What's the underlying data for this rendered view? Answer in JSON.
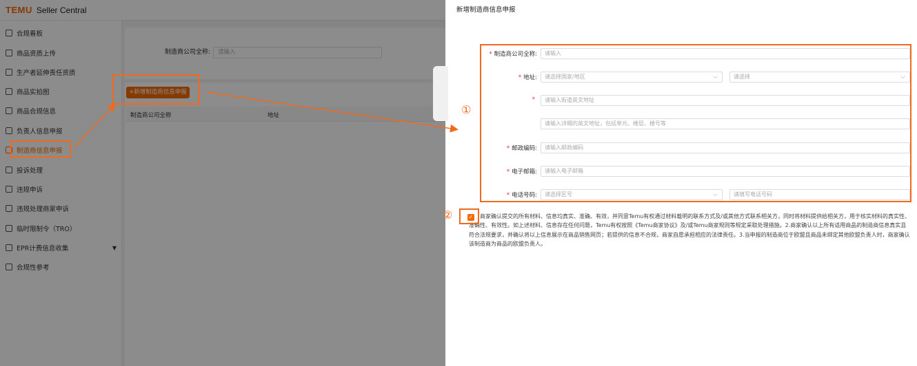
{
  "header": {
    "logo": "TEMU",
    "app_name": "Seller Central"
  },
  "sidebar": {
    "items": [
      {
        "label": "合规看板",
        "icon": "dashboard-icon"
      },
      {
        "label": "商品资质上传",
        "icon": "upload-icon"
      },
      {
        "label": "生产者延伸责任资质",
        "icon": "certificate-icon"
      },
      {
        "label": "商品实拍图",
        "icon": "photo-icon"
      },
      {
        "label": "商品合规信息",
        "icon": "document-icon"
      },
      {
        "label": "负责人信息申报",
        "icon": "person-icon"
      },
      {
        "label": "制造商信息申报",
        "icon": "factory-icon"
      },
      {
        "label": "投诉处理",
        "icon": "alert-icon"
      },
      {
        "label": "违规申诉",
        "icon": "appeal-icon"
      },
      {
        "label": "违规处理商家申诉",
        "icon": "store-icon"
      },
      {
        "label": "临时限制令（TRO）",
        "icon": "calendar-icon"
      },
      {
        "label": "EPR计费信息收集",
        "icon": "billing-icon"
      },
      {
        "label": "合规性参考",
        "icon": "book-icon"
      }
    ]
  },
  "main": {
    "filter_label": "制造商公司全称:",
    "filter_placeholder": "请输入",
    "add_button": "+新增制造商信息申报",
    "columns": [
      "制造商公司全称",
      "地址"
    ]
  },
  "drawer": {
    "title": "新增制造商信息申报",
    "fields": {
      "company": {
        "label": "制造商公司全称:",
        "placeholder": "请输入"
      },
      "address": {
        "label": "地址:",
        "country_placeholder": "请选择国家/地区",
        "region_placeholder": "请选择"
      },
      "street": {
        "placeholder": "请输入街道英文地址"
      },
      "detail": {
        "placeholder": "请输入详细的英文地址，包括单元、楼层、楼号等"
      },
      "postal": {
        "label": "邮政编码:",
        "placeholder": "请输入邮政编码"
      },
      "email": {
        "label": "电子邮箱:",
        "placeholder": "请输入电子邮箱"
      },
      "phone": {
        "label": "电话号码:",
        "area_placeholder": "请选择区号",
        "number_placeholder": "请填写电话号码"
      }
    },
    "consent_text": "商家确认提交的所有材料、信息均真实、准确、有效，并同意Temu有权通过材料载明的联系方式及/或其他方式联系相关方，同时将材料提供给相关方，用于核实材料的真实性、准确性、有效性。如上述材料、信息存在任何问题，Temu有权按照《Temu商家协议》及/或Temu商家规则等规定采取处理措施。2.商家确认以上所有适用商品的制造商信息真实且符合法规要求，并确认将以上信息展示在商品销售网页；若提供的信息不合规，商家自愿承担相应的法律责任。3.当申报的制造商位于欧盟且商品未绑定其他欧盟负责人时，商家确认该制造商为商品的欧盟负责人。",
    "consent_checked": true
  },
  "annotations": {
    "marker_1": "①",
    "marker_2": "②",
    "color": "#f06a1e"
  },
  "colors": {
    "accent": "#f56a00",
    "required": "#e22233"
  }
}
